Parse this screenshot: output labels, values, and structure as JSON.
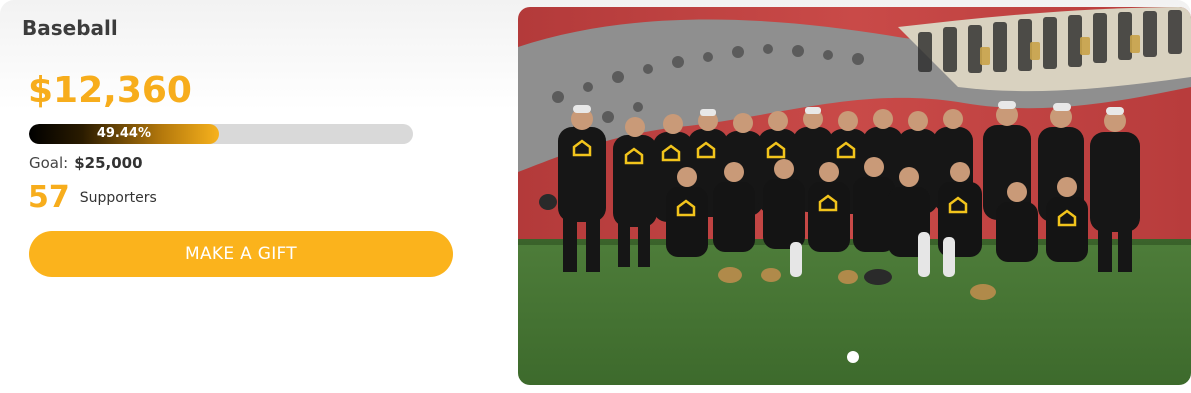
{
  "campaign": {
    "title": "Baseball",
    "raised": "$12,360",
    "progress_percent": 49.44,
    "progress_label": "49.44%",
    "goal_label": "Goal:",
    "goal_value": "$25,000",
    "supporters_count": "57",
    "supporters_label": "Supporters",
    "cta_label": "MAKE A GIFT"
  },
  "carousel": {
    "slide_count": 1,
    "active_slide": 1
  },
  "colors": {
    "accent": "#f7ad1c",
    "button": "#fbb31c",
    "progress_track": "#d9d9d9"
  }
}
